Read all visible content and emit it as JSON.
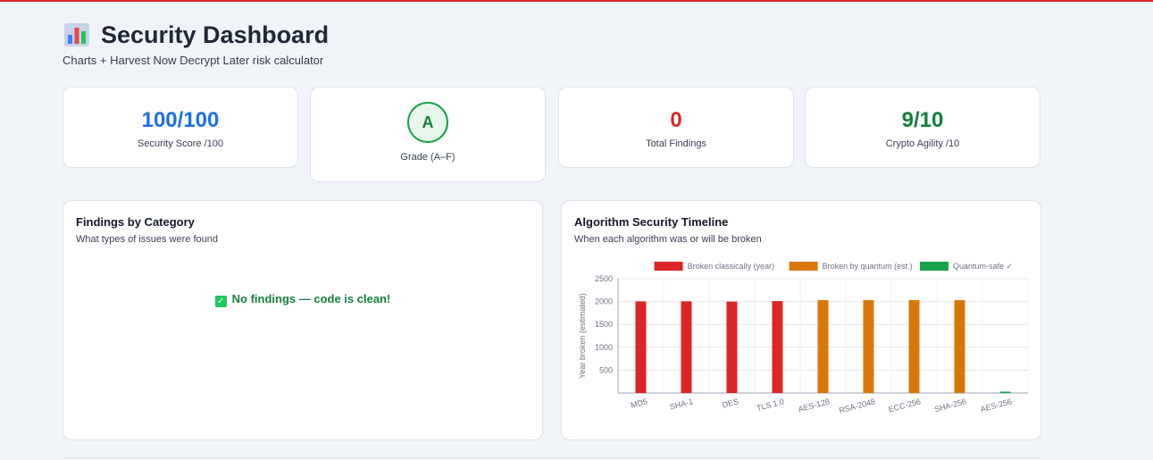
{
  "header": {
    "logo_icon": "bar-chart-icon",
    "title": "Security Dashboard",
    "subtitle": "Charts + Harvest Now Decrypt Later risk calculator"
  },
  "stats": {
    "security_score": {
      "value": "100/100",
      "label": "Security Score /100",
      "color": "#1d6fe8"
    },
    "grade": {
      "value": "A",
      "label": "Grade (A–F)",
      "color": "#16a34a"
    },
    "total_findings": {
      "value": "0",
      "label": "Total Findings",
      "color": "#dc2626"
    },
    "crypto_agility": {
      "value": "9/10",
      "label": "Crypto Agility /10",
      "color": "#15803d"
    }
  },
  "findings_panel": {
    "title": "Findings by Category",
    "subtitle": "What types of issues were found",
    "empty_message": "No findings — code is clean!",
    "empty_icon": "check-box-icon"
  },
  "timeline_panel": {
    "title": "Algorithm Security Timeline",
    "subtitle": "When each algorithm was or will be broken"
  },
  "chart_data": {
    "type": "bar",
    "categories": [
      "MD5",
      "SHA-1",
      "DES",
      "TLS 1.0",
      "AES-128",
      "RSA-2048",
      "ECC-256",
      "SHA-256",
      "AES-256"
    ],
    "series": [
      {
        "name": "Broken classically (year)",
        "color": "#dc2626",
        "values": [
          2004,
          2005,
          1999,
          2011,
          null,
          null,
          null,
          null,
          null
        ]
      },
      {
        "name": "Broken by quantum (est.)",
        "color": "#d97706",
        "values": [
          null,
          null,
          null,
          null,
          2030,
          2030,
          2030,
          2030,
          null
        ]
      },
      {
        "name": "Quantum-safe ✓",
        "color": "#16a34a",
        "values": [
          null,
          null,
          null,
          null,
          null,
          null,
          null,
          null,
          30
        ]
      }
    ],
    "ylabel": "Year broken (estimated)",
    "xlabel": "",
    "ylim": [
      0,
      2500
    ],
    "yticks": [
      500,
      1000,
      1500,
      2000,
      2500
    ],
    "grid": true,
    "legend_position": "top"
  }
}
